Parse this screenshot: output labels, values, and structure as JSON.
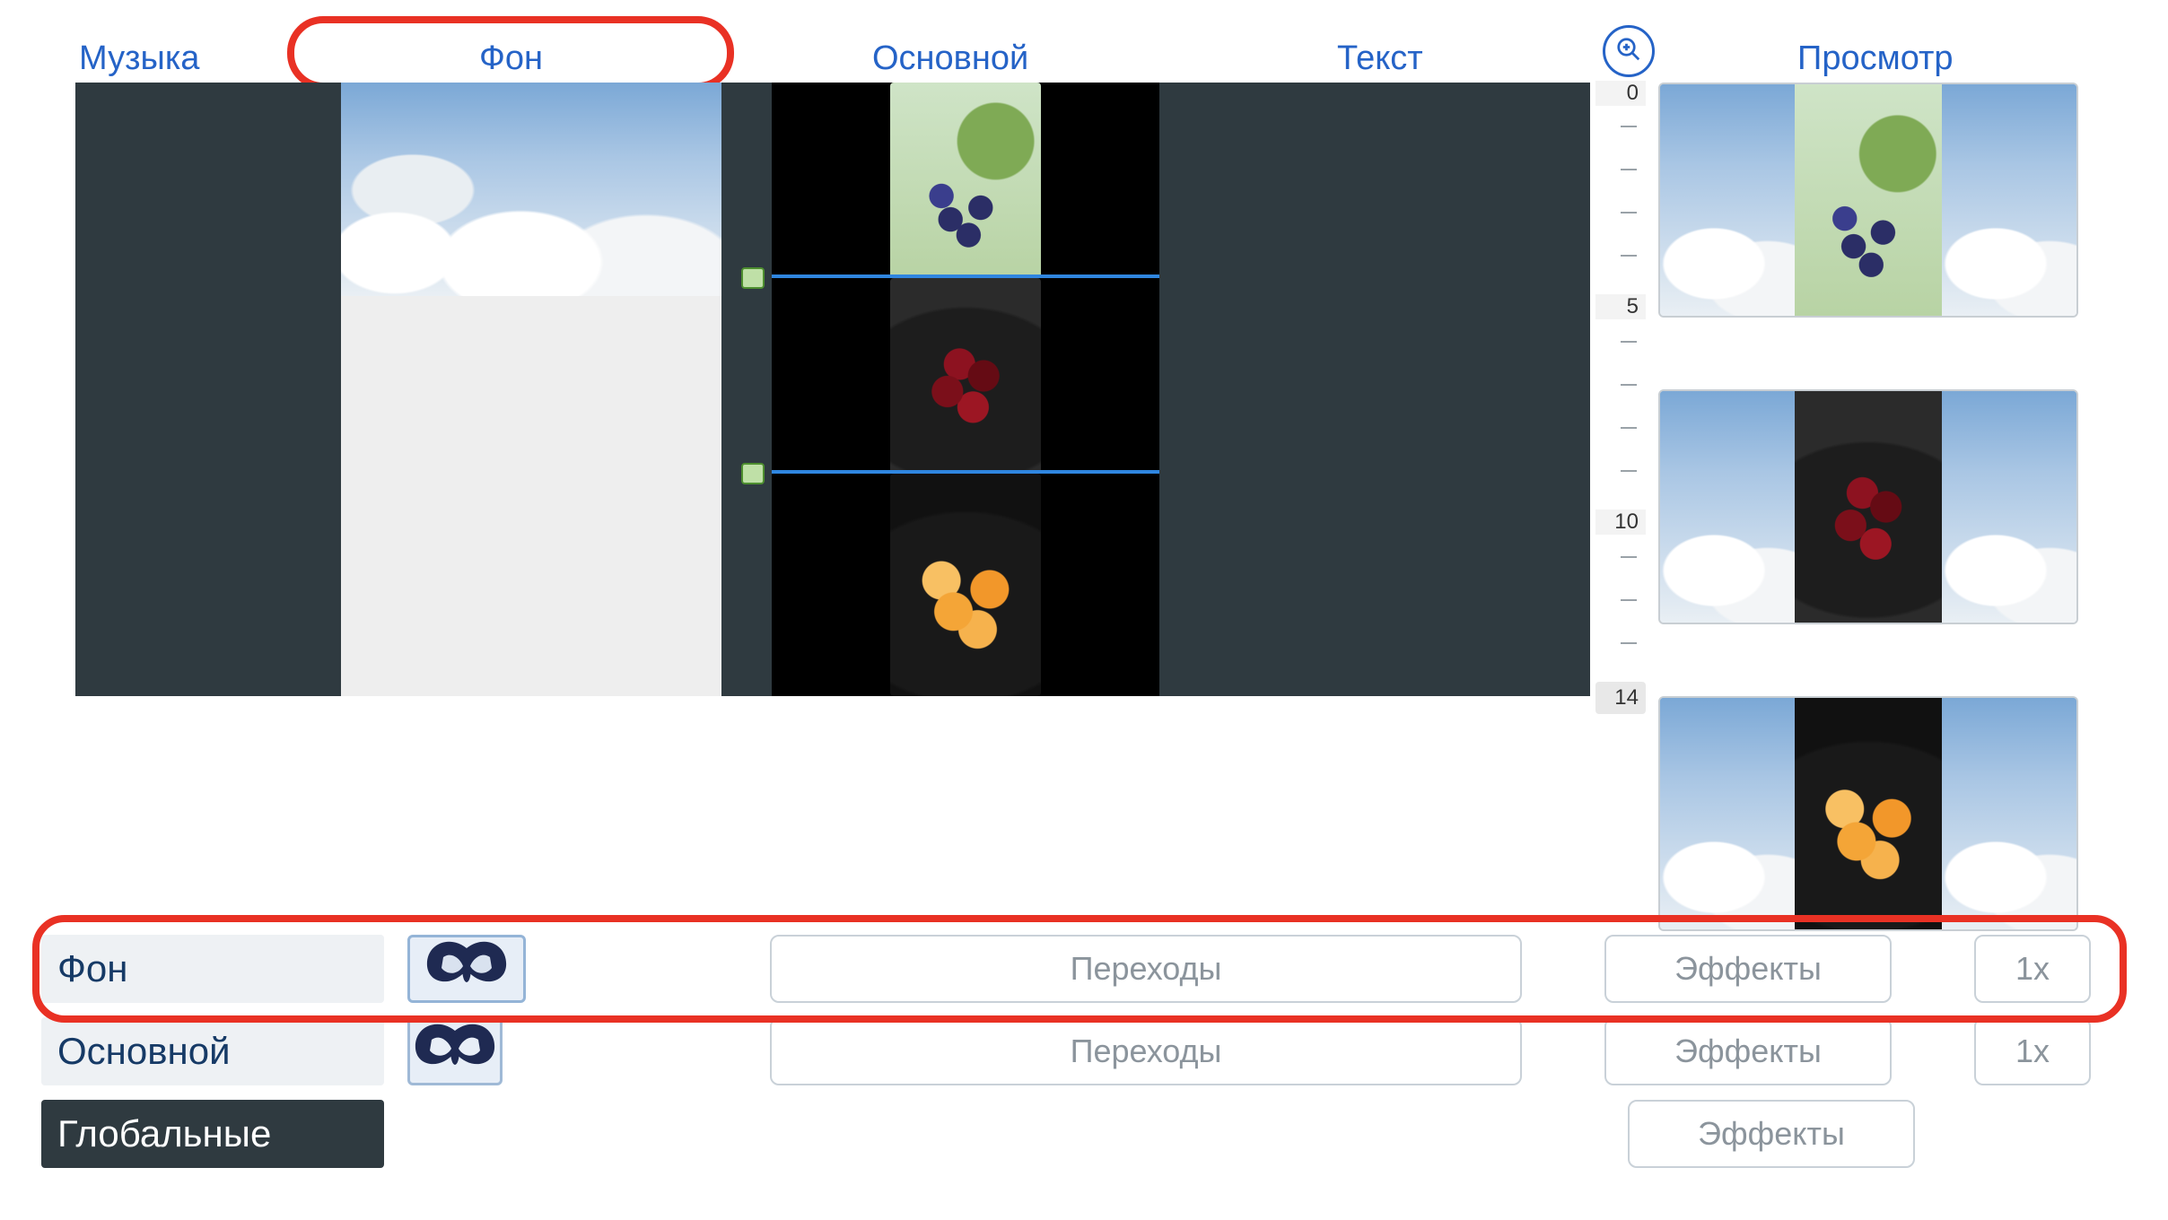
{
  "tabs": {
    "music": "Музыка",
    "background": "Фон",
    "main": "Основной",
    "text": "Текст",
    "preview": "Просмотр"
  },
  "ruler": {
    "marks": [
      "0",
      "5",
      "10",
      "14"
    ]
  },
  "layers": [
    {
      "name": "Фон",
      "transitions_label": "Переходы",
      "effects_label": "Эффекты",
      "multiplier": "1x"
    },
    {
      "name": "Основной",
      "transitions_label": "Переходы",
      "effects_label": "Эффекты",
      "multiplier": "1x"
    },
    {
      "name": "Глобальные",
      "effects_label": "Эффекты"
    }
  ],
  "highlights": {
    "active_tab": "background",
    "active_row_index": 0
  }
}
